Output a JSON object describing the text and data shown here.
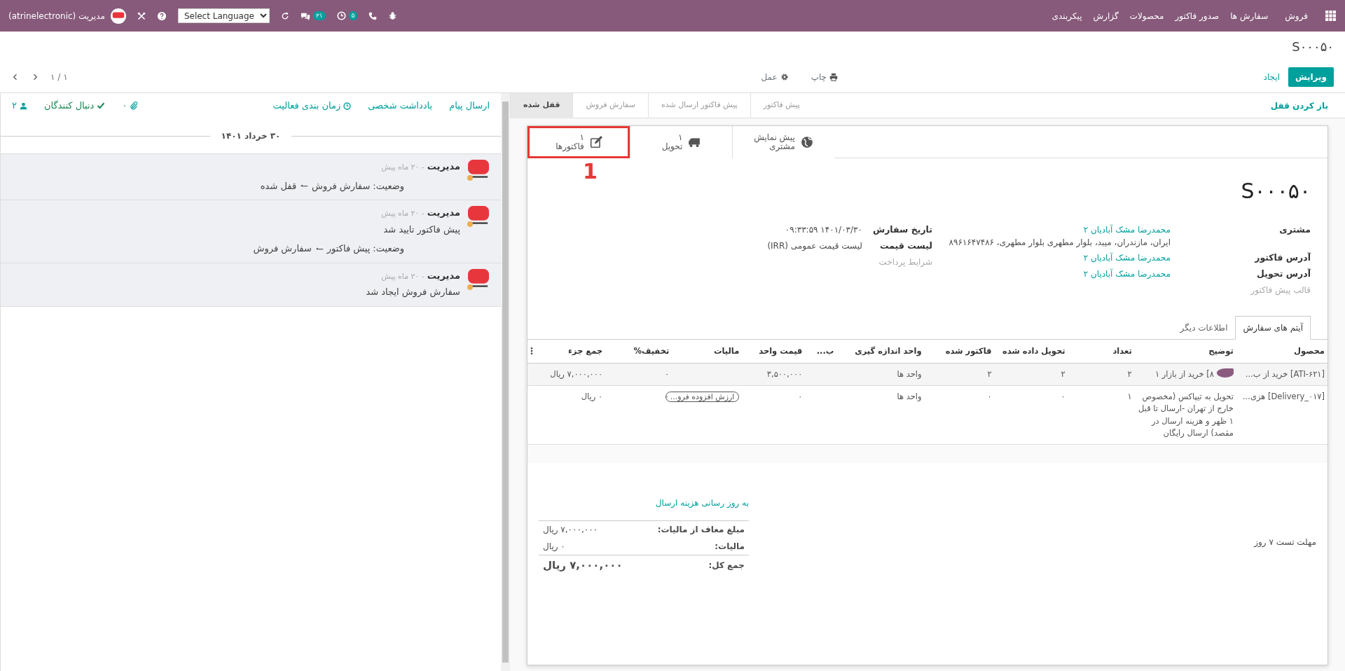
{
  "navbar": {
    "app_name": "فروش",
    "menu": [
      "سفارش ها",
      "صدور فاکتور",
      "محصولات",
      "گزارش",
      "پیکربندی"
    ],
    "user": "مدیریت (atrinelectronic)",
    "language_select": "Select Language",
    "messages_count": "۲۱",
    "activities_count": "۵"
  },
  "breadcrumb": "S۰۰۰۵۰",
  "buttons": {
    "edit": "ویرایش",
    "create": "ایجاد",
    "print": "چاپ",
    "action": "عمل",
    "pager": "۱ / ۱"
  },
  "statusbar": {
    "unlock_button": "باز کردن قفل",
    "stages": [
      {
        "label": "پیش فاکتور",
        "selected": false
      },
      {
        "label": "پیش فاکتور ارسال شده",
        "selected": false
      },
      {
        "label": "سفارش فروش",
        "selected": false
      },
      {
        "label": "قفل شده",
        "selected": true
      }
    ]
  },
  "stat_buttons": [
    {
      "kind": "globe",
      "value": "پیش نمایش",
      "label": "مشتری",
      "highlighted": false
    },
    {
      "kind": "truck",
      "value": "۱",
      "label": "تحویل",
      "highlighted": false
    },
    {
      "kind": "edit",
      "value": "۱",
      "label": "فاکتورها",
      "highlighted": true
    }
  ],
  "annotation": "1",
  "title": "S۰۰۰۵۰",
  "fields_right": [
    {
      "label": "مشتری",
      "kind": "link",
      "value": "محمدرضا مشک آبادیان ۲",
      "extra": "ایران، مازندران، میبد، بلوار مطهری بلوار مطهری، ۸۹۶۱۶۴۷۴۸۶"
    },
    {
      "label": "آدرس فاکتور",
      "kind": "link",
      "value": "محمدرضا مشک آبادیان ۲"
    },
    {
      "label": "آدرس تحویل",
      "kind": "link",
      "value": "محمدرضا مشک آبادیان ۲"
    },
    {
      "label": "قالب پیش فاکتور",
      "kind": "empty"
    }
  ],
  "fields_left": [
    {
      "label": "تاریخ سفارش",
      "kind": "date",
      "value": "۰۹:۳۳:۵۹ ۱۴۰۱/۰۳/۳۰"
    },
    {
      "label": "لیست قیمت",
      "kind": "text",
      "value": "لیست قیمت عمومی (IRR)"
    },
    {
      "label": "شرایط پرداخت",
      "kind": "empty"
    }
  ],
  "tabs": [
    {
      "label": "آیتم های سفارش",
      "selected": true
    },
    {
      "label": "اطلاعات دیگر",
      "selected": false
    }
  ],
  "table": {
    "columns": [
      "محصول",
      "توضیح",
      "تعداد",
      "تحویل داده شده",
      "فاکتور شده",
      "واحد اندازه گیری",
      "ب...",
      "قیمت واحد",
      "مالیات",
      "تخفیف%",
      "جمع جزء"
    ],
    "rows": [
      {
        "redacted": true,
        "cells": [
          "[ATI-۶۲۱] خرید از ب...",
          "۸] خرید از بازار ۱",
          "۲",
          "۲",
          "۲",
          "واحد ها",
          "",
          "۳,۵۰۰,۰۰۰",
          "",
          "۰",
          "۷,۰۰۰,۰۰۰ ریال"
        ]
      },
      {
        "redacted": false,
        "tax_tag": "ارزش افزوده فرو...",
        "cells": [
          "[Delivery_۰۱۷] هزی...",
          "تحویل به تیپاکس (مخصوص خارج از تهران -ارسال تا قبل ۱ ظهر و هزینه ارسال در مقصد) ارسال رایگان",
          "۱",
          "۰",
          "۰",
          "واحد ها",
          "",
          "۰",
          "",
          "۰",
          "۰ ریال"
        ]
      }
    ]
  },
  "note": "مهلت تست ۷ روز",
  "update_shipping_link": "به روز رسانی هزینه ارسال",
  "totals": [
    {
      "label": "مبلغ معاف از مالیات:",
      "value": "۷,۰۰۰,۰۰۰ ریال",
      "kind": "line"
    },
    {
      "label": "مالیات:",
      "value": "۰ ریال",
      "kind": "line"
    },
    {
      "label": "جمع کل:",
      "value": "۷,۰۰۰,۰۰۰ ریال",
      "kind": "total"
    }
  ],
  "chatter": {
    "actions": [
      "ارسال پیام",
      "یادداشت شخصی",
      "زمان بندی فعالیت"
    ],
    "attachments_count": "۰",
    "follow": "دنبال کنندگان",
    "followers_count": "۲",
    "date_separator": "۳۰ خرداد ۱۴۰۱",
    "messages": [
      {
        "author": "مدیریت",
        "time": "- ۲۰ ماه پیش",
        "tracking": {
          "field": "وضعیت:",
          "old": "سفارش فروش",
          "new": "قفل شده"
        }
      },
      {
        "author": "مدیریت",
        "time": "- ۲۰ ماه پیش",
        "body": "پیش فاکتور تایید شد",
        "tracking": {
          "field": "وضعیت:",
          "old": "پیش فاکتور",
          "new": "سفارش فروش"
        }
      },
      {
        "author": "مدیریت",
        "time": "- ۲۰ ماه پیش",
        "body": "سفارش فروش ایجاد شد"
      }
    ]
  }
}
